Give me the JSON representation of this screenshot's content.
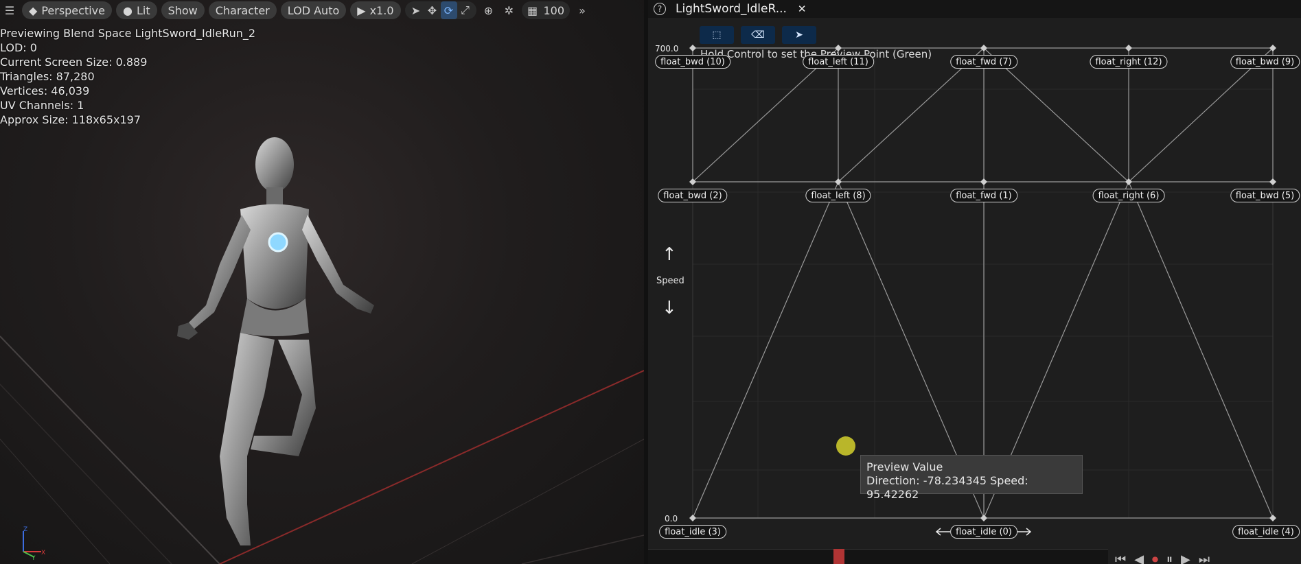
{
  "viewport": {
    "toolbar": {
      "perspective": "Perspective",
      "lit": "Lit",
      "show": "Show",
      "character": "Character",
      "lod": "LOD Auto",
      "play_speed": "x1.0",
      "grid_size": "100"
    },
    "stats": [
      "Previewing Blend Space LightSword_IdleRun_2",
      "LOD: 0",
      "Current Screen Size: 0.889",
      "Triangles: 87,280",
      "Vertices: 46,039",
      "UV Channels: 1",
      "Approx Size: 118x65x197"
    ],
    "gizmo": {
      "x": "X",
      "y": "Y",
      "z": "Z"
    }
  },
  "blendspace": {
    "tab_title": "LightSword_IdleR...",
    "close_glyph": "✕",
    "help_glyph": "?",
    "hint": "Hold Control to set the Preview Point (Green)",
    "y_max": "700.0",
    "y_min": "0.0",
    "y_axis_name": "Speed",
    "samples": [
      {
        "name": "float_bwd (10)",
        "col": 0,
        "row": 0
      },
      {
        "name": "float_left (11)",
        "col": 1,
        "row": 0
      },
      {
        "name": "float_fwd (7)",
        "col": 2,
        "row": 0
      },
      {
        "name": "float_right (12)",
        "col": 3,
        "row": 0
      },
      {
        "name": "float_bwd (9)",
        "col": 4,
        "row": 0
      },
      {
        "name": "float_bwd (2)",
        "col": 0,
        "row": 1
      },
      {
        "name": "float_left (8)",
        "col": 1,
        "row": 1
      },
      {
        "name": "float_fwd (1)",
        "col": 2,
        "row": 1
      },
      {
        "name": "float_right (6)",
        "col": 3,
        "row": 1
      },
      {
        "name": "float_bwd (5)",
        "col": 4,
        "row": 1
      },
      {
        "name": "float_idle (3)",
        "col": 0,
        "row": 2
      },
      {
        "name": "float_idle (0)",
        "col": 2,
        "row": 2
      },
      {
        "name": "float_idle (4)",
        "col": 4,
        "row": 2
      }
    ],
    "tooltip": {
      "title": "Preview Value",
      "value": "Direction: -78.234345  Speed: 95.42262"
    }
  },
  "colors": {
    "accent": "#2d4b6e",
    "preview_point": "#b9b62a",
    "timeline_marker": "#b03434"
  }
}
